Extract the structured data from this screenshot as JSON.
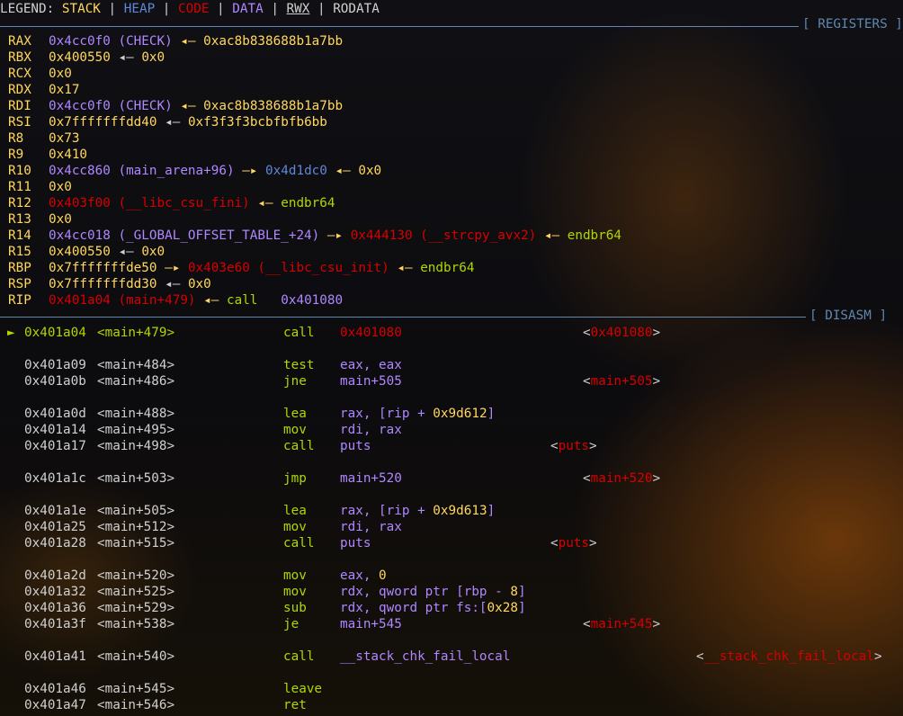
{
  "legend": {
    "prefix": "LEGEND: ",
    "items": [
      {
        "label": "STACK",
        "color": "#ffd75f"
      },
      {
        "label": "HEAP",
        "color": "#5f87d7"
      },
      {
        "label": "CODE",
        "color": "#d70000"
      },
      {
        "label": "DATA",
        "color": "#af87ff"
      },
      {
        "label": "RWX",
        "color": "#d0d0d0"
      },
      {
        "label": "RODATA",
        "color": "#d0d0d0"
      }
    ],
    "separator": " | "
  },
  "sections": {
    "registers": "[ REGISTERS ]",
    "disasm": "[ DISASM ]"
  },
  "registers": [
    {
      "name": "RAX",
      "parts": [
        [
          "0x4cc0f0 (CHECK)",
          "p"
        ],
        [
          " ◂— ",
          "y"
        ],
        [
          "0xac8b838688b1a7bb",
          "y"
        ]
      ]
    },
    {
      "name": "RBX",
      "parts": [
        [
          "0x400550",
          "y"
        ],
        [
          " ◂— ",
          "w"
        ],
        [
          "0x0",
          "y"
        ]
      ]
    },
    {
      "name": "RCX",
      "parts": [
        [
          "0x0",
          "y"
        ]
      ]
    },
    {
      "name": "RDX",
      "parts": [
        [
          "0x17",
          "y"
        ]
      ]
    },
    {
      "name": "RDI",
      "parts": [
        [
          "0x4cc0f0 (CHECK)",
          "p"
        ],
        [
          " ◂— ",
          "y"
        ],
        [
          "0xac8b838688b1a7bb",
          "y"
        ]
      ]
    },
    {
      "name": "RSI",
      "parts": [
        [
          "0x7fffffffdd40",
          "y"
        ],
        [
          " ◂— ",
          "w"
        ],
        [
          "0xf3f3f3bcbfbfb6bb",
          "y"
        ]
      ]
    },
    {
      "name": "R8",
      "parts": [
        [
          "0x73",
          "y"
        ]
      ]
    },
    {
      "name": "R9",
      "parts": [
        [
          "0x410",
          "y"
        ]
      ]
    },
    {
      "name": "R10",
      "parts": [
        [
          "0x4cc860 (main_arena+96)",
          "p"
        ],
        [
          " —▸ ",
          "y"
        ],
        [
          "0x4d1dc0",
          "b"
        ],
        [
          " ◂— ",
          "y"
        ],
        [
          "0x0",
          "y"
        ]
      ]
    },
    {
      "name": "R11",
      "parts": [
        [
          "0x0",
          "y"
        ]
      ]
    },
    {
      "name": "R12",
      "parts": [
        [
          "0x403f00 (__libc_csu_fini)",
          "r"
        ],
        [
          " ◂— ",
          "y"
        ],
        [
          "endbr64",
          "g"
        ]
      ]
    },
    {
      "name": "R13",
      "parts": [
        [
          "0x0",
          "y"
        ]
      ]
    },
    {
      "name": "R14",
      "parts": [
        [
          "0x4cc018 (_GLOBAL_OFFSET_TABLE_+24)",
          "p"
        ],
        [
          " —▸ ",
          "y"
        ],
        [
          "0x444130 (__strcpy_avx2)",
          "r"
        ],
        [
          " ◂— ",
          "y"
        ],
        [
          "endbr64",
          "g"
        ]
      ]
    },
    {
      "name": "R15",
      "parts": [
        [
          "0x400550",
          "y"
        ],
        [
          " ◂— ",
          "w"
        ],
        [
          "0x0",
          "y"
        ]
      ]
    },
    {
      "name": "RBP",
      "parts": [
        [
          "0x7fffffffde50",
          "y"
        ],
        [
          " —▸ ",
          "y"
        ],
        [
          "0x403e60 (__libc_csu_init)",
          "r"
        ],
        [
          " ◂— ",
          "y"
        ],
        [
          "endbr64",
          "g"
        ]
      ]
    },
    {
      "name": "RSP",
      "parts": [
        [
          "0x7fffffffdd30",
          "y"
        ],
        [
          " ◂— ",
          "w"
        ],
        [
          "0x0",
          "y"
        ]
      ]
    },
    {
      "name": "RIP",
      "parts": [
        [
          "0x401a04 (main+479)",
          "r"
        ],
        [
          " ◂— ",
          "y"
        ],
        [
          "call   ",
          "g"
        ],
        [
          "0x401080",
          "p"
        ]
      ]
    }
  ],
  "disasm": [
    {
      "row": 0,
      "current": true,
      "marker": "►",
      "addr": "0x401a04",
      "sym": "<main+479>",
      "mnem": "call",
      "ops": [
        [
          "0x401080",
          "r"
        ]
      ],
      "target": "<0x401080>",
      "tcol": 648
    },
    {
      "row": 2,
      "addr": "0x401a09",
      "sym": "<main+484>",
      "mnem": "test",
      "ops": [
        [
          "eax, eax",
          "p"
        ]
      ]
    },
    {
      "row": 3,
      "addr": "0x401a0b",
      "sym": "<main+486>",
      "mnem": "jne",
      "ops": [
        [
          "main+505",
          "p"
        ]
      ],
      "target": "<main+505>",
      "tcol": 648
    },
    {
      "row": 5,
      "addr": "0x401a0d",
      "sym": "<main+488>",
      "mnem": "lea",
      "ops": [
        [
          "rax, [rip + ",
          "p"
        ],
        [
          "0x9d612",
          "y"
        ],
        [
          "]",
          "p"
        ]
      ]
    },
    {
      "row": 6,
      "addr": "0x401a14",
      "sym": "<main+495>",
      "mnem": "mov",
      "ops": [
        [
          "rdi, rax",
          "p"
        ]
      ]
    },
    {
      "row": 7,
      "addr": "0x401a17",
      "sym": "<main+498>",
      "mnem": "call",
      "ops": [
        [
          "puts",
          "p"
        ]
      ],
      "target": "<puts>",
      "tcol": 612
    },
    {
      "row": 9,
      "addr": "0x401a1c",
      "sym": "<main+503>",
      "mnem": "jmp",
      "ops": [
        [
          "main+520",
          "p"
        ]
      ],
      "target": "<main+520>",
      "tcol": 648
    },
    {
      "row": 11,
      "addr": "0x401a1e",
      "sym": "<main+505>",
      "mnem": "lea",
      "ops": [
        [
          "rax, [rip + ",
          "p"
        ],
        [
          "0x9d613",
          "y"
        ],
        [
          "]",
          "p"
        ]
      ]
    },
    {
      "row": 12,
      "addr": "0x401a25",
      "sym": "<main+512>",
      "mnem": "mov",
      "ops": [
        [
          "rdi, rax",
          "p"
        ]
      ]
    },
    {
      "row": 13,
      "addr": "0x401a28",
      "sym": "<main+515>",
      "mnem": "call",
      "ops": [
        [
          "puts",
          "p"
        ]
      ],
      "target": "<puts>",
      "tcol": 612
    },
    {
      "row": 15,
      "addr": "0x401a2d",
      "sym": "<main+520>",
      "mnem": "mov",
      "ops": [
        [
          "eax, ",
          "p"
        ],
        [
          "0",
          "y"
        ]
      ]
    },
    {
      "row": 16,
      "addr": "0x401a32",
      "sym": "<main+525>",
      "mnem": "mov",
      "ops": [
        [
          "rdx, qword ptr [rbp - ",
          "p"
        ],
        [
          "8",
          "y"
        ],
        [
          "]",
          "p"
        ]
      ]
    },
    {
      "row": 17,
      "addr": "0x401a36",
      "sym": "<main+529>",
      "mnem": "sub",
      "ops": [
        [
          "rdx, qword ptr fs:[",
          "p"
        ],
        [
          "0x28",
          "y"
        ],
        [
          "]",
          "p"
        ]
      ]
    },
    {
      "row": 18,
      "addr": "0x401a3f",
      "sym": "<main+538>",
      "mnem": "je",
      "ops": [
        [
          "main+545",
          "p"
        ]
      ],
      "target": "<main+545>",
      "tcol": 648
    },
    {
      "row": 20,
      "addr": "0x401a41",
      "sym": "<main+540>",
      "mnem": "call",
      "ops": [
        [
          "__stack_chk_fail_local",
          "p"
        ]
      ],
      "target": "<__stack_chk_fail_local>",
      "tcol": 774
    },
    {
      "row": 22,
      "addr": "0x401a46",
      "sym": "<main+545>",
      "mnem": "leave",
      "ops": []
    },
    {
      "row": 23,
      "addr": "0x401a47",
      "sym": "<main+546>",
      "mnem": "ret",
      "ops": []
    }
  ]
}
